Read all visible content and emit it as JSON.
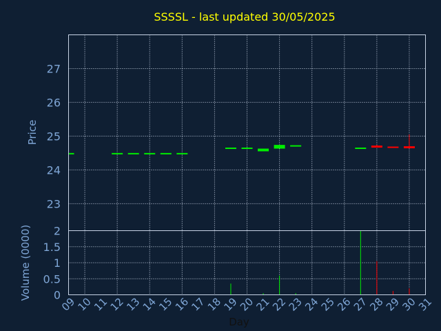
{
  "chart_data": {
    "title": "SSSSL - last updated 30/05/2025",
    "type": "candlestick",
    "grid": true,
    "x": {
      "label": "Day",
      "ticks": [
        "09",
        "10",
        "11",
        "12",
        "13",
        "14",
        "15",
        "16",
        "17",
        "18",
        "19",
        "20",
        "21",
        "22",
        "23",
        "24",
        "25",
        "26",
        "27",
        "28",
        "29",
        "30",
        "31"
      ]
    },
    "price": {
      "label": "Price",
      "ylim": [
        22.2,
        28.0
      ],
      "ticks": [
        "23",
        "24",
        "25",
        "26",
        "27"
      ],
      "candles": [
        {
          "day": "09",
          "open": 24.48,
          "close": 24.48,
          "high": 24.48,
          "low": 24.48,
          "color": "#00ee00"
        },
        {
          "day": "12",
          "open": 24.48,
          "close": 24.48,
          "high": 24.48,
          "low": 24.48,
          "color": "#00ee00"
        },
        {
          "day": "13",
          "open": 24.48,
          "close": 24.48,
          "high": 24.48,
          "low": 24.48,
          "color": "#00ee00"
        },
        {
          "day": "14",
          "open": 24.48,
          "close": 24.48,
          "high": 24.48,
          "low": 24.48,
          "color": "#00ee00"
        },
        {
          "day": "15",
          "open": 24.48,
          "close": 24.48,
          "high": 24.48,
          "low": 24.48,
          "color": "#00ee00"
        },
        {
          "day": "16",
          "open": 24.48,
          "close": 24.48,
          "high": 24.48,
          "low": 24.48,
          "color": "#00ee00"
        },
        {
          "day": "19",
          "open": 24.62,
          "close": 24.64,
          "high": 24.64,
          "low": 24.62,
          "color": "#00ee00"
        },
        {
          "day": "20",
          "open": 24.62,
          "close": 24.64,
          "high": 24.64,
          "low": 24.62,
          "color": "#00ee00"
        },
        {
          "day": "21",
          "open": 24.55,
          "close": 24.63,
          "high": 24.63,
          "low": 24.55,
          "color": "#00ee00"
        },
        {
          "day": "22",
          "open": 24.63,
          "close": 24.74,
          "high": 24.74,
          "low": 24.63,
          "color": "#00ee00"
        },
        {
          "day": "23",
          "open": 24.67,
          "close": 24.71,
          "high": 24.71,
          "low": 24.67,
          "color": "#00ee00"
        },
        {
          "day": "27",
          "open": 24.61,
          "close": 24.64,
          "high": 24.64,
          "low": 24.61,
          "color": "#00ee00"
        },
        {
          "day": "28",
          "open": 24.72,
          "close": 24.66,
          "high": 24.74,
          "low": 24.66,
          "color": "#ff0000"
        },
        {
          "day": "29",
          "open": 24.67,
          "close": 24.65,
          "high": 24.67,
          "low": 24.65,
          "color": "#ff0000"
        },
        {
          "day": "30",
          "open": 24.7,
          "close": 24.64,
          "high": 25.05,
          "low": 24.64,
          "color": "#ff0000"
        }
      ]
    },
    "volume": {
      "label": "Volume (0000)",
      "ylim": [
        0,
        2
      ],
      "ticks": [
        "0",
        "0.5",
        "1",
        "1.5",
        "2"
      ],
      "bars": [
        {
          "day": "19",
          "value": 0.35,
          "color": "#00ee00"
        },
        {
          "day": "21",
          "value": 0.05,
          "color": "#00ee00"
        },
        {
          "day": "22",
          "value": 0.6,
          "color": "#00ee00"
        },
        {
          "day": "23",
          "value": 0.05,
          "color": "#00ee00"
        },
        {
          "day": "27",
          "value": 2.0,
          "color": "#00ee00"
        },
        {
          "day": "28",
          "value": 1.05,
          "color": "#ff0000"
        },
        {
          "day": "29",
          "value": 0.12,
          "color": "#ff0000"
        },
        {
          "day": "30",
          "value": 0.2,
          "color": "#ff0000"
        }
      ]
    }
  }
}
